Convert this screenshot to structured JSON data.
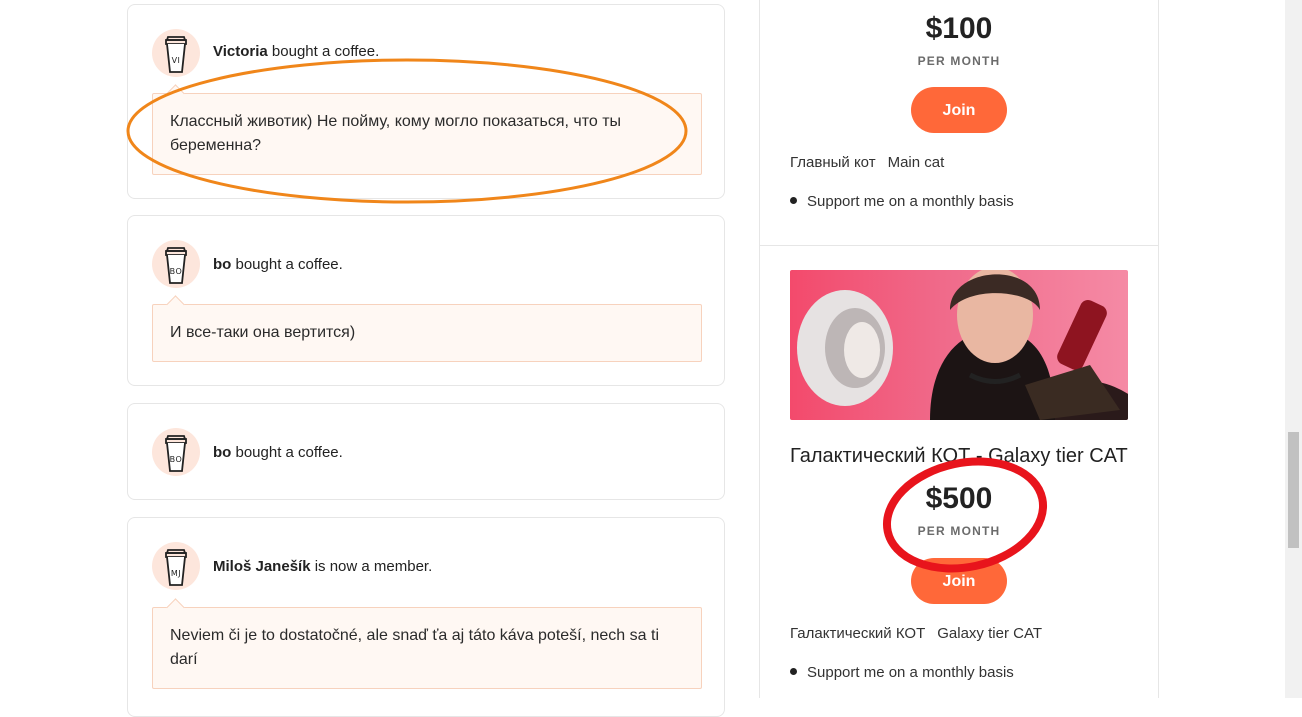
{
  "feed": [
    {
      "initials": "VI",
      "name": "Victoria",
      "action": "bought a coffee.",
      "message": "Классный животик) Не пойму, кому могло показаться, что ты беременна?"
    },
    {
      "initials": "BO",
      "name": "bo",
      "action": "bought a coffee.",
      "message": "И все-таки она вертится)"
    },
    {
      "initials": "BO",
      "name": "bo",
      "action": "bought a coffee.",
      "message": ""
    },
    {
      "initials": "MJ",
      "name": "Miloš Janešík",
      "action": "is now a member.",
      "message": "Neviem či je to dostatočné, ale snaď ťa aj táto káva poteší, nech sa ti darí"
    }
  ],
  "tiers": [
    {
      "price": "$100",
      "period": "PER MONTH",
      "join_label": "Join",
      "desc_ru": "Главный кот",
      "desc_en": "Main cat",
      "benefit": "Support me on a monthly basis"
    },
    {
      "name": "Галактический КОТ - Galaxy tier CAT",
      "price": "$500",
      "period": "PER MONTH",
      "join_label": "Join",
      "desc_ru": "Галактический КОТ",
      "desc_en": "Galaxy tier CAT",
      "benefit": "Support me on a monthly basis"
    }
  ],
  "colors": {
    "accent": "#ff6839",
    "bubble_bg": "#fff8f3",
    "annotation_orange": "#f0861a",
    "annotation_red": "#e8141c"
  }
}
